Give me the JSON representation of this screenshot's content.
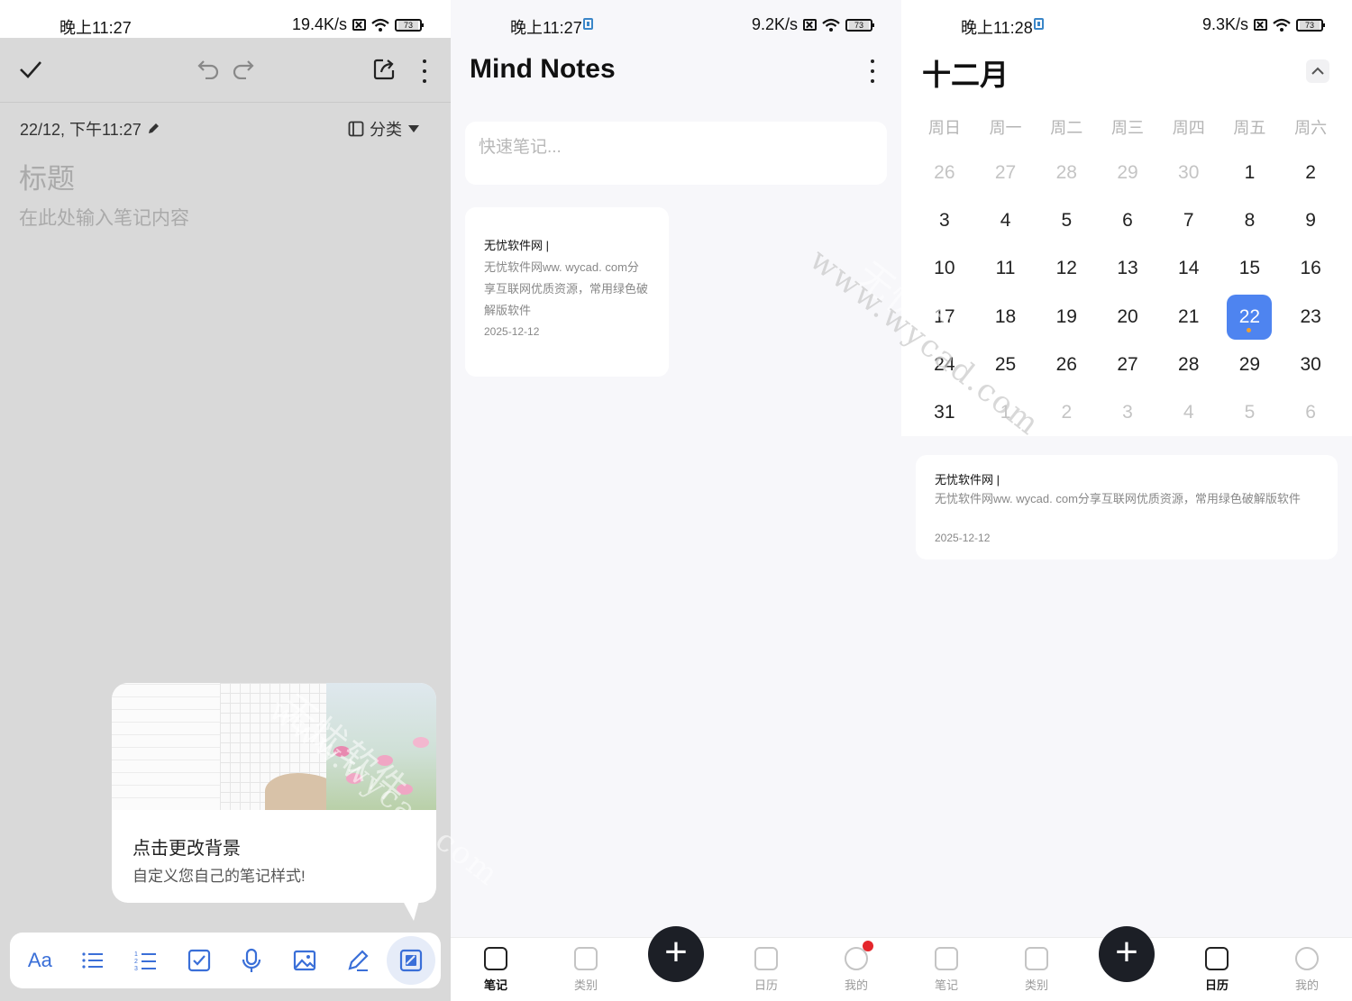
{
  "panel1": {
    "status": {
      "time": "晚上11:27",
      "speed": "19.4K/s",
      "battery": "73"
    },
    "editor": {
      "date": "22/12, 下午11:27",
      "category_label": "分类",
      "title_placeholder": "标题",
      "body_placeholder": "在此处输入笔记内容"
    },
    "tip": {
      "title": "点击更改背景",
      "subtitle": "自定义您自己的笔记样式!"
    },
    "format_bar": {
      "text_style_label": "Aa"
    }
  },
  "panel2": {
    "status": {
      "time": "晚上11:27",
      "speed": "9.2K/s",
      "battery": "73"
    },
    "app_title": "Mind Notes",
    "quick_note_placeholder": "快速笔记...",
    "note": {
      "title": "无忧软件网 |",
      "body": "无忧软件网ww. wycad. com分享互联网优质资源，常用绿色破解版软件",
      "date": "2025-12-12"
    },
    "nav": [
      {
        "label": "笔记",
        "icon": "note-icon",
        "active": true
      },
      {
        "label": "类别",
        "icon": "category-icon",
        "active": false
      },
      {
        "label": "日历",
        "icon": "calendar-icon",
        "active": false
      },
      {
        "label": "我的",
        "icon": "profile-icon",
        "active": false
      }
    ],
    "fab": "+"
  },
  "panel3": {
    "status": {
      "time": "晚上11:28",
      "speed": "9.3K/s",
      "battery": "73"
    },
    "month": "十二月",
    "weekdays": [
      "周日",
      "周一",
      "周二",
      "周三",
      "周四",
      "周五",
      "周六"
    ],
    "days": [
      [
        "26",
        "27",
        "28",
        "29",
        "30",
        "1",
        "2"
      ],
      [
        "3",
        "4",
        "5",
        "6",
        "7",
        "8",
        "9"
      ],
      [
        "10",
        "11",
        "12",
        "13",
        "14",
        "15",
        "16"
      ],
      [
        "17",
        "18",
        "19",
        "20",
        "21",
        "22",
        "23"
      ],
      [
        "24",
        "25",
        "26",
        "27",
        "28",
        "29",
        "30"
      ],
      [
        "31",
        "1",
        "2",
        "3",
        "4",
        "5",
        "6"
      ]
    ],
    "selected_day": "22",
    "note": {
      "title": "无忧软件网 |",
      "body": "无忧软件网ww. wycad. com分享互联网优质资源，常用绿色破解版软件",
      "date": "2025-12-12"
    },
    "nav": [
      {
        "label": "笔记",
        "icon": "note-icon",
        "active": false
      },
      {
        "label": "类别",
        "icon": "category-icon",
        "active": false
      },
      {
        "label": "日历",
        "icon": "calendar-icon",
        "active": true
      },
      {
        "label": "我的",
        "icon": "profile-icon",
        "active": false
      }
    ],
    "fab": "+"
  },
  "watermark": {
    "brand": "无忧软件",
    "domain": "www.wycad.com"
  },
  "colors": {
    "accent": "#4e84f0",
    "fab": "#1c1f26",
    "badge": "#e4262b",
    "format_icons": "#3a6fd8"
  }
}
